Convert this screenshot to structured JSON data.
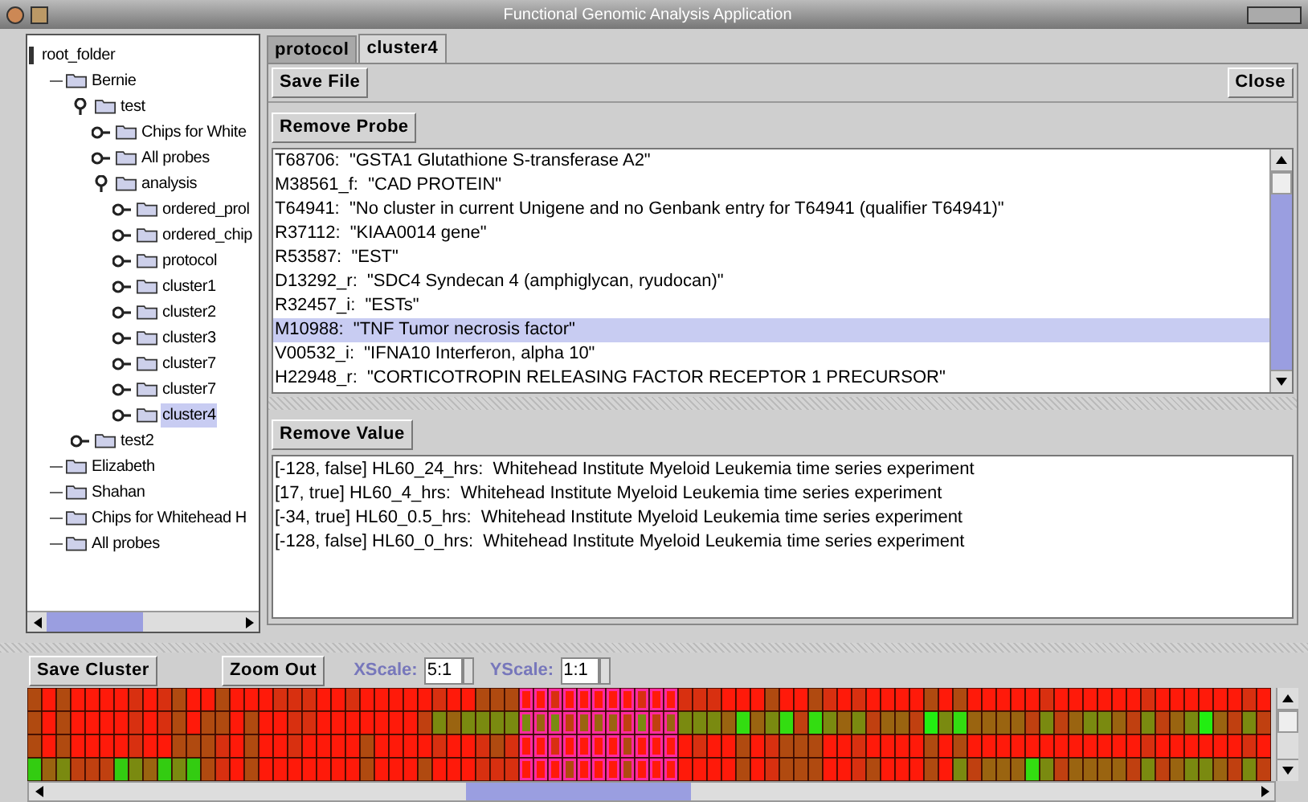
{
  "window": {
    "title": "Functional Genomic Analysis Application"
  },
  "tree": {
    "label": "root_folder",
    "children": [
      {
        "label": "Bernie",
        "children": [
          {
            "label": "test",
            "expanded": true,
            "selected": false,
            "children": [
              {
                "label": "Chips for White",
                "expanded": false,
                "selected": false
              },
              {
                "label": "All probes",
                "expanded": false,
                "selected": false
              },
              {
                "label": "analysis",
                "expanded": true,
                "selected": false,
                "children": [
                  {
                    "label": "ordered_prol",
                    "expanded": false,
                    "selected": false
                  },
                  {
                    "label": "ordered_chip",
                    "expanded": false,
                    "selected": false
                  },
                  {
                    "label": "protocol",
                    "expanded": false,
                    "selected": false
                  },
                  {
                    "label": "cluster1",
                    "expanded": false,
                    "selected": false
                  },
                  {
                    "label": "cluster2",
                    "expanded": false,
                    "selected": false
                  },
                  {
                    "label": "cluster3",
                    "expanded": false,
                    "selected": false
                  },
                  {
                    "label": "cluster7",
                    "expanded": false,
                    "selected": false
                  },
                  {
                    "label": "cluster7",
                    "expanded": false,
                    "selected": false
                  },
                  {
                    "label": "cluster4",
                    "expanded": false,
                    "selected": true
                  }
                ]
              }
            ]
          },
          {
            "label": "test2",
            "expanded": false,
            "selected": false
          }
        ]
      },
      {
        "label": "Elizabeth"
      },
      {
        "label": "Shahan"
      },
      {
        "label": "Chips for Whitehead H"
      },
      {
        "label": "All probes"
      }
    ]
  },
  "tabs": [
    {
      "label": "protocol",
      "selected": false
    },
    {
      "label": "cluster4",
      "selected": true
    }
  ],
  "file_buttons": {
    "save": "Save File",
    "close": "Close"
  },
  "probes": {
    "button": "Remove Probe",
    "items": [
      {
        "text": "T68706:  \"GSTA1 Glutathione S-transferase A2\"",
        "selected": false
      },
      {
        "text": "M38561_f:  \"CAD PROTEIN\"",
        "selected": false
      },
      {
        "text": "T64941:  \"No cluster in current Unigene and no Genbank entry for T64941 (qualifier T64941)\"",
        "selected": false
      },
      {
        "text": "R37112:  \"KIAA0014 gene\"",
        "selected": false
      },
      {
        "text": "R53587:  \"EST\"",
        "selected": false
      },
      {
        "text": "D13292_r:  \"SDC4 Syndecan 4 (amphiglycan, ryudocan)\"",
        "selected": false
      },
      {
        "text": "R32457_i:  \"ESTs\"",
        "selected": false
      },
      {
        "text": "M10988:  \"TNF Tumor necrosis factor\"",
        "selected": true
      },
      {
        "text": "V00532_i:  \"IFNA10 Interferon, alpha 10\"",
        "selected": false
      },
      {
        "text": "H22948_r:  \"CORTICOTROPIN RELEASING FACTOR RECEPTOR 1 PRECURSOR\"",
        "selected": false
      }
    ]
  },
  "values": {
    "button": "Remove Value",
    "items": [
      "[-128, false] HL60_24_hrs:  Whitehead Institute Myeloid Leukemia time series experiment",
      "[17, true] HL60_4_hrs:  Whitehead Institute Myeloid Leukemia time series experiment",
      "[-34, true] HL60_0.5_hrs:  Whitehead Institute Myeloid Leukemia time series experiment",
      "[-128, false] HL60_0_hrs:  Whitehead Institute Myeloid Leukemia time series experiment"
    ]
  },
  "cluster_toolbar": {
    "save": "Save Cluster",
    "zoom": "Zoom Out",
    "xscale_label": "XScale:",
    "xscale_value": "5:1",
    "yscale_label": "YScale:",
    "yscale_value": "1:1"
  }
}
